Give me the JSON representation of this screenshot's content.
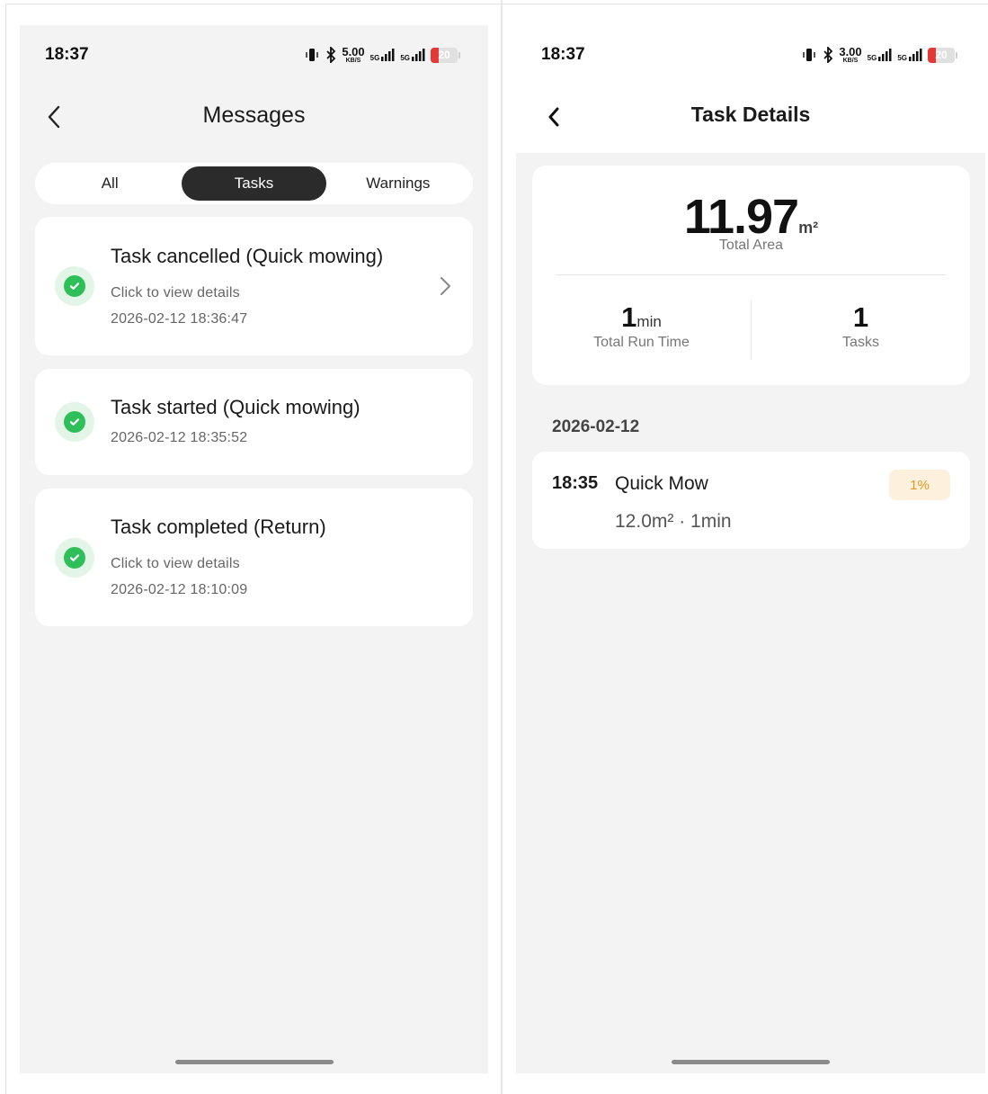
{
  "status_bar": {
    "time": "18:37",
    "left_speed_value": "5.00",
    "right_speed_value": "3.00",
    "speed_unit": "KB/S",
    "network_label": "5G",
    "battery_level": "20",
    "battery_color": "#e53935"
  },
  "messages_screen": {
    "title": "Messages",
    "tabs": [
      {
        "label": "All",
        "active": false
      },
      {
        "label": "Tasks",
        "active": true
      },
      {
        "label": "Warnings",
        "active": false
      }
    ],
    "messages": [
      {
        "title": "Task cancelled (Quick mowing)",
        "subtitle": "Click to view details",
        "timestamp": "2026-02-12 18:36:47",
        "icon": "check-circle-icon",
        "has_chevron": true
      },
      {
        "title": "Task started (Quick mowing)",
        "subtitle": "",
        "timestamp": "2026-02-12 18:35:52",
        "icon": "check-circle-icon",
        "has_chevron": false
      },
      {
        "title": "Task completed (Return)",
        "subtitle": "Click to view details",
        "timestamp": "2026-02-12 18:10:09",
        "icon": "check-circle-icon",
        "has_chevron": false
      }
    ]
  },
  "task_details_screen": {
    "title": "Task Details",
    "summary": {
      "total_area_value": "11.97",
      "total_area_unit": "m²",
      "total_area_label": "Total Area",
      "run_time_value": "1",
      "run_time_unit": "min",
      "run_time_label": "Total Run Time",
      "tasks_value": "1",
      "tasks_label": "Tasks"
    },
    "date_group": "2026-02-12",
    "task": {
      "time": "18:35",
      "name": "Quick Mow",
      "progress_badge": "1%",
      "meta": "12.0m² · 1min"
    }
  },
  "colors": {
    "accent_green": "#2fbf5a",
    "badge_orange": "#e8961e",
    "active_tab": "#2b2b2b"
  }
}
